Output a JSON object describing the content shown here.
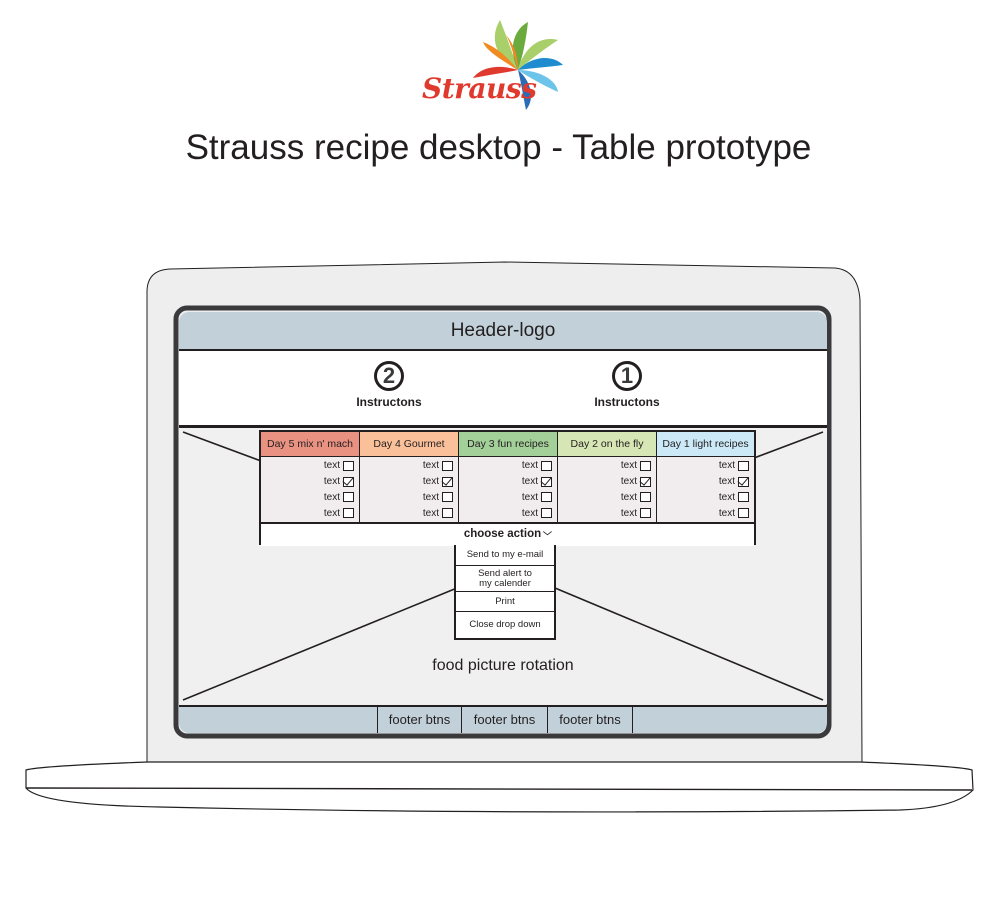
{
  "brand": {
    "logo_text": "Strauss",
    "logo_colors": [
      "#e03a2f",
      "#f28a24",
      "#6bab3e",
      "#a9cf6a",
      "#1e8ccf",
      "#6cc4ea",
      "#2a6cb5"
    ]
  },
  "page_title": "Strauss recipe desktop - Table prototype",
  "screen": {
    "header": {
      "label": "Header-logo",
      "color": "#c2d1d9"
    },
    "instructions": [
      {
        "step": "2",
        "label": "Instructons"
      },
      {
        "step": "1",
        "label": "Instructons"
      }
    ],
    "table": {
      "columns": [
        {
          "title": "Day 5 mix n' mach",
          "color": "#ea9282",
          "items": [
            {
              "label": "text",
              "checked": false
            },
            {
              "label": "text",
              "checked": true
            },
            {
              "label": "text",
              "checked": false
            },
            {
              "label": "text",
              "checked": false
            }
          ]
        },
        {
          "title": "Day 4 Gourmet",
          "color": "#f9c09a",
          "items": [
            {
              "label": "text",
              "checked": false
            },
            {
              "label": "text",
              "checked": true
            },
            {
              "label": "text",
              "checked": false
            },
            {
              "label": "text",
              "checked": false
            }
          ]
        },
        {
          "title": "Day 3 fun recipes",
          "color": "#a3cf99",
          "items": [
            {
              "label": "text",
              "checked": false
            },
            {
              "label": "text",
              "checked": true
            },
            {
              "label": "text",
              "checked": false
            },
            {
              "label": "text",
              "checked": false
            }
          ]
        },
        {
          "title": "Day 2 on the fly",
          "color": "#d6e6b4",
          "items": [
            {
              "label": "text",
              "checked": false
            },
            {
              "label": "text",
              "checked": true
            },
            {
              "label": "text",
              "checked": false
            },
            {
              "label": "text",
              "checked": false
            }
          ]
        },
        {
          "title": "Day 1 light recipes",
          "color": "#cbe9f7",
          "items": [
            {
              "label": "text",
              "checked": false
            },
            {
              "label": "text",
              "checked": true
            },
            {
              "label": "text",
              "checked": false
            },
            {
              "label": "text",
              "checked": false
            }
          ]
        }
      ],
      "choose_action": {
        "label": "choose action",
        "icon": "chevron-down-icon",
        "glyph": "⌄"
      }
    },
    "dropdown": {
      "items": [
        {
          "label": "Send  to my e-mail"
        },
        {
          "label": "Send alert to\nmy calender"
        },
        {
          "label": "Print"
        },
        {
          "label": "Close drop down"
        }
      ]
    },
    "food_area": {
      "label": "food picture rotation"
    },
    "footer": {
      "buttons": [
        {
          "label": "footer btns"
        },
        {
          "label": "footer btns"
        },
        {
          "label": "footer btns"
        }
      ],
      "color": "#c2d1d9"
    }
  }
}
